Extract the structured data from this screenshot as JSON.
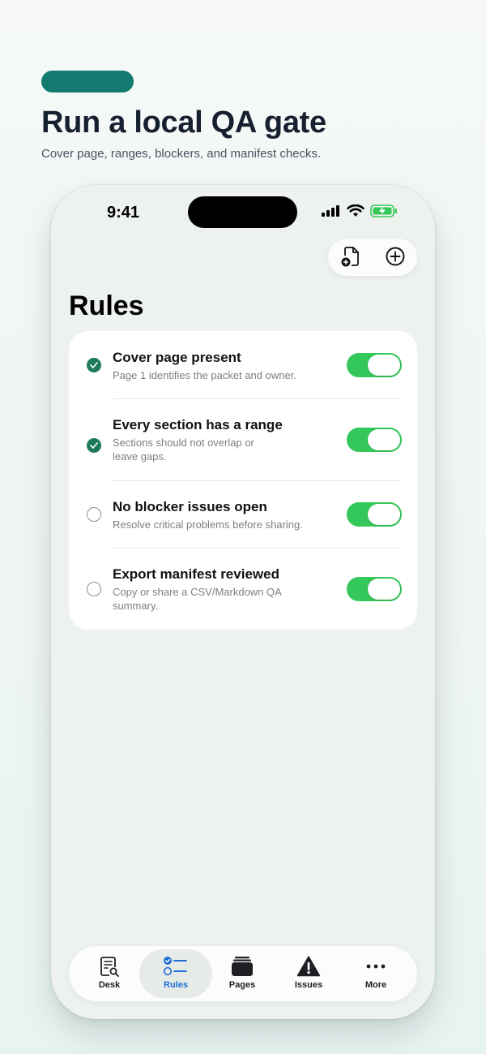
{
  "promo": {
    "headline": "Run a local QA gate",
    "subline": "Cover page, ranges, blockers, and manifest checks.",
    "accent_color": "#137a6f"
  },
  "status_bar": {
    "time": "9:41",
    "icons": [
      "cellular-signal-icon",
      "wifi-icon",
      "battery-charging-icon"
    ]
  },
  "toolbar": {
    "buttons": [
      "add-document-icon",
      "add-circle-icon"
    ]
  },
  "screen": {
    "title": "Rules"
  },
  "rules": [
    {
      "title": "Cover page present",
      "description": "Page 1 identifies the packet and owner.",
      "done": true,
      "enabled": true
    },
    {
      "title": "Every section has a range",
      "description": "Sections should not overlap or leave gaps.",
      "done": true,
      "enabled": true
    },
    {
      "title": "No blocker issues open",
      "description": "Resolve critical problems before sharing.",
      "done": false,
      "enabled": true
    },
    {
      "title": "Export manifest reviewed",
      "description": "Copy or share a CSV/Markdown QA summary.",
      "done": false,
      "enabled": true
    }
  ],
  "tabs": [
    {
      "label": "Desk",
      "icon": "document-search-icon",
      "active": false
    },
    {
      "label": "Rules",
      "icon": "checklist-icon",
      "active": true
    },
    {
      "label": "Pages",
      "icon": "pages-stack-icon",
      "active": false
    },
    {
      "label": "Issues",
      "icon": "warning-icon",
      "active": false
    },
    {
      "label": "More",
      "icon": "more-dots-icon",
      "active": false
    }
  ],
  "colors": {
    "toggle_on": "#34c759",
    "check_done": "#1f7a5c",
    "tab_active": "#1f6fd6"
  }
}
